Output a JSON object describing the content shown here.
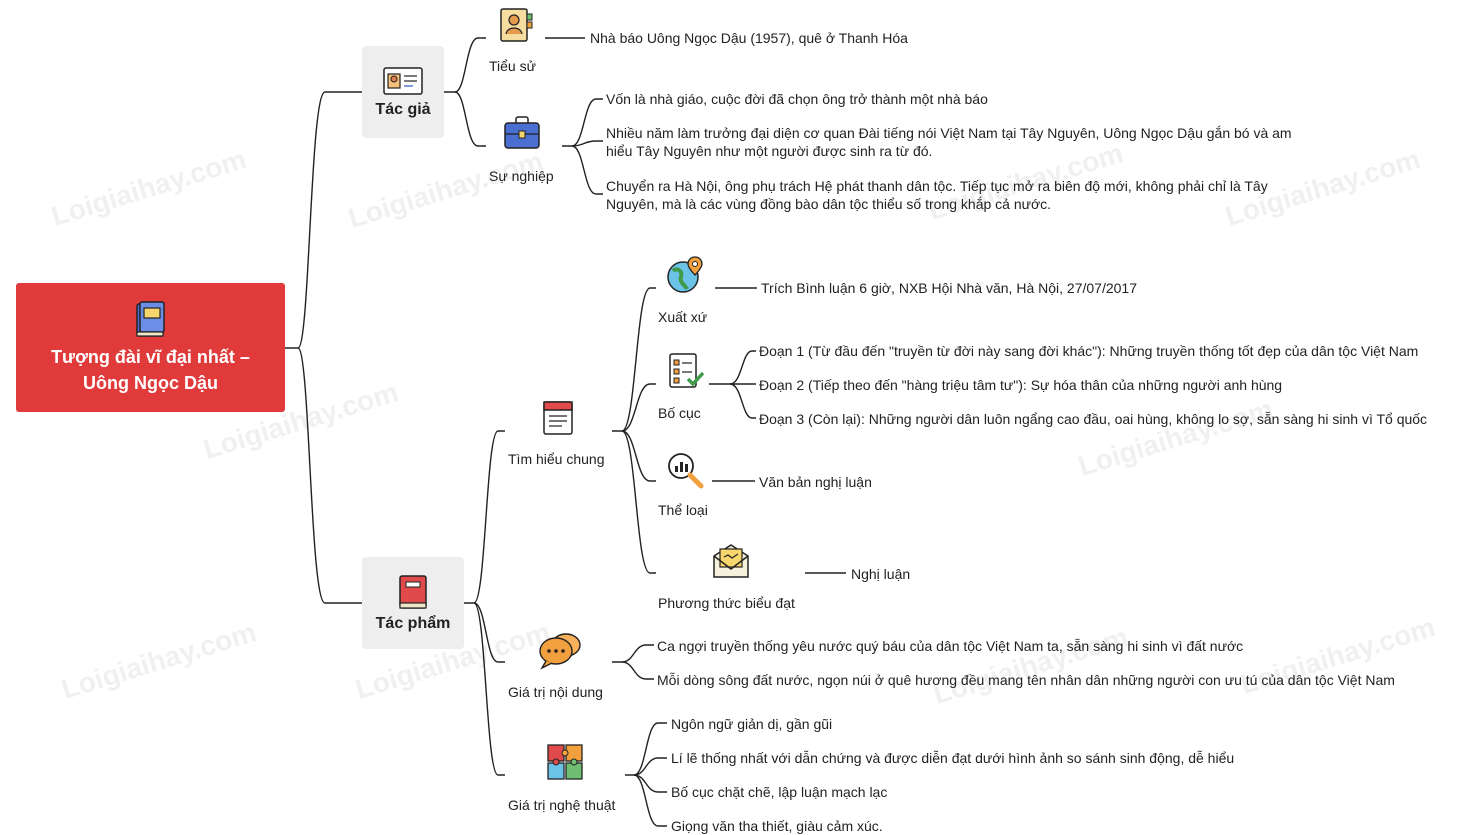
{
  "root": {
    "title_line1": "Tượng đài vĩ đại nhất –",
    "title_line2": "Uông Ngọc Dậu",
    "icon": "book-icon"
  },
  "colors": {
    "root_bg": "#e03a3a",
    "box_bg": "#eeeeee",
    "line": "#222222"
  },
  "tac_gia": {
    "label": "Tác giả",
    "icon": "id-card-icon",
    "tieu_su": {
      "label": "Tiểu sử",
      "icon": "profile-document-icon",
      "text": "Nhà báo Uông Ngọc Dậu (1957), quê ở Thanh Hóa"
    },
    "su_nghiep": {
      "label": "Sự nghiệp",
      "icon": "briefcase-icon",
      "items": [
        "Vốn là nhà giáo, cuộc đời đã chọn ông trở thành một nhà báo",
        "Nhiều năm làm trưởng đại diện cơ quan Đài tiếng nói Việt Nam tại Tây Nguyên, Uông Ngọc Dậu gắn bó và am hiểu Tây Nguyên như một người được sinh ra từ đó.",
        "Chuyển ra Hà Nội, ông phụ trách Hệ phát thanh dân tộc. Tiếp tục mở ra biên độ mới, không phải chỉ là Tây Nguyên, mà là các vùng đồng bào dân tộc thiểu số trong khắp cả nước."
      ]
    }
  },
  "tac_pham": {
    "label": "Tác phẩm",
    "icon": "red-book-icon",
    "tim_hieu_chung": {
      "label": "Tìm hiểu chung",
      "icon": "notebook-icon",
      "xuat_xu": {
        "label": "Xuất xứ",
        "icon": "globe-pin-icon",
        "text": "Trích Bình luận 6 giờ, NXB Hội Nhà văn, Hà Nội, 27/07/2017"
      },
      "bo_cuc": {
        "label": "Bố cục",
        "icon": "checklist-icon",
        "items": [
          "Đoạn 1 (Từ đầu đến \"truyền từ đời này sang đời khác\"): Những truyền thống tốt đẹp của dân tộc Việt Nam",
          "Đoạn 2 (Tiếp theo đến \"hàng triệu tâm tư\"): Sự hóa thân của những người anh hùng",
          "Đoạn 3 (Còn lại): Những người dân luôn ngẩng cao đầu, oai hùng, không lo sợ, sẵn sàng hi sinh vì Tổ quốc"
        ]
      },
      "the_loai": {
        "label": "Thể loại",
        "icon": "magnifier-chart-icon",
        "text": "Văn bản nghị luận"
      },
      "phuong_thuc": {
        "label": "Phương thức biểu đạt",
        "icon": "envelope-icon",
        "text": "Nghị luận"
      }
    },
    "gia_tri_noi_dung": {
      "label": "Giá trị nội dung",
      "icon": "chat-bubbles-icon",
      "items": [
        "Ca ngợi truyền thống yêu nước quý báu của dân tộc Việt Nam ta, sẵn sàng hi sinh vì đất nước",
        "Mỗi dòng sông đất nước, ngọn núi ở quê hương đều mang tên nhân dân những người con ưu tú của dân tộc Việt Nam"
      ]
    },
    "gia_tri_nghe_thuat": {
      "label": "Giá trị nghệ thuật",
      "icon": "puzzle-icon",
      "items": [
        "Ngôn ngữ giản dị, gần gũi",
        "Lí lẽ thống nhất với dẫn chứng và được diễn đạt dưới hình ảnh so sánh sinh động, dễ hiểu",
        "Bố cục chặt chẽ, lập luận mạch lạc",
        "Giọng văn tha thiết, giàu cảm xúc."
      ]
    }
  },
  "watermark": "Loigiaihay.com"
}
